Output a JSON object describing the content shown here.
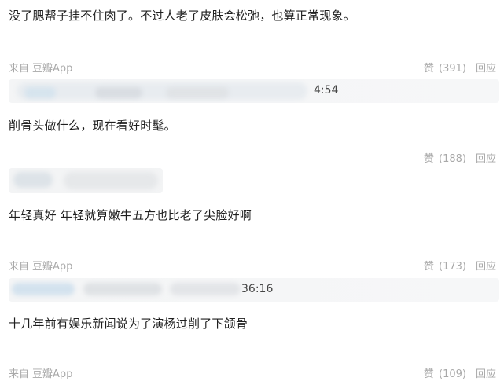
{
  "comments": [
    {
      "text": "没了腮帮子挂不住肉了。不过人老了皮肤会松弛，也算正常现象。",
      "source_prefix": "来自",
      "source_app": "豆瓣App",
      "like_label": "赞",
      "like_count": "(391)",
      "reply_label": "回应",
      "author_time": "4:54"
    },
    {
      "text": "削骨头做什么，现在看好时髦。",
      "like_label": "赞",
      "like_count": "(188)",
      "reply_label": "回应",
      "author_time": ""
    },
    {
      "text": "年轻真好 年轻就算嫩牛五方也比老了尖脸好啊",
      "source_prefix": "来自",
      "source_app": "豆瓣App",
      "like_label": "赞",
      "like_count": "(173)",
      "reply_label": "回应",
      "author_time": "36:16"
    },
    {
      "text": "十几年前有娱乐新闻说为了演杨过削了下颌骨",
      "source_prefix": "来自",
      "source_app": "豆瓣App",
      "like_label": "赞",
      "like_count": "(109)",
      "reply_label": "回应"
    }
  ]
}
